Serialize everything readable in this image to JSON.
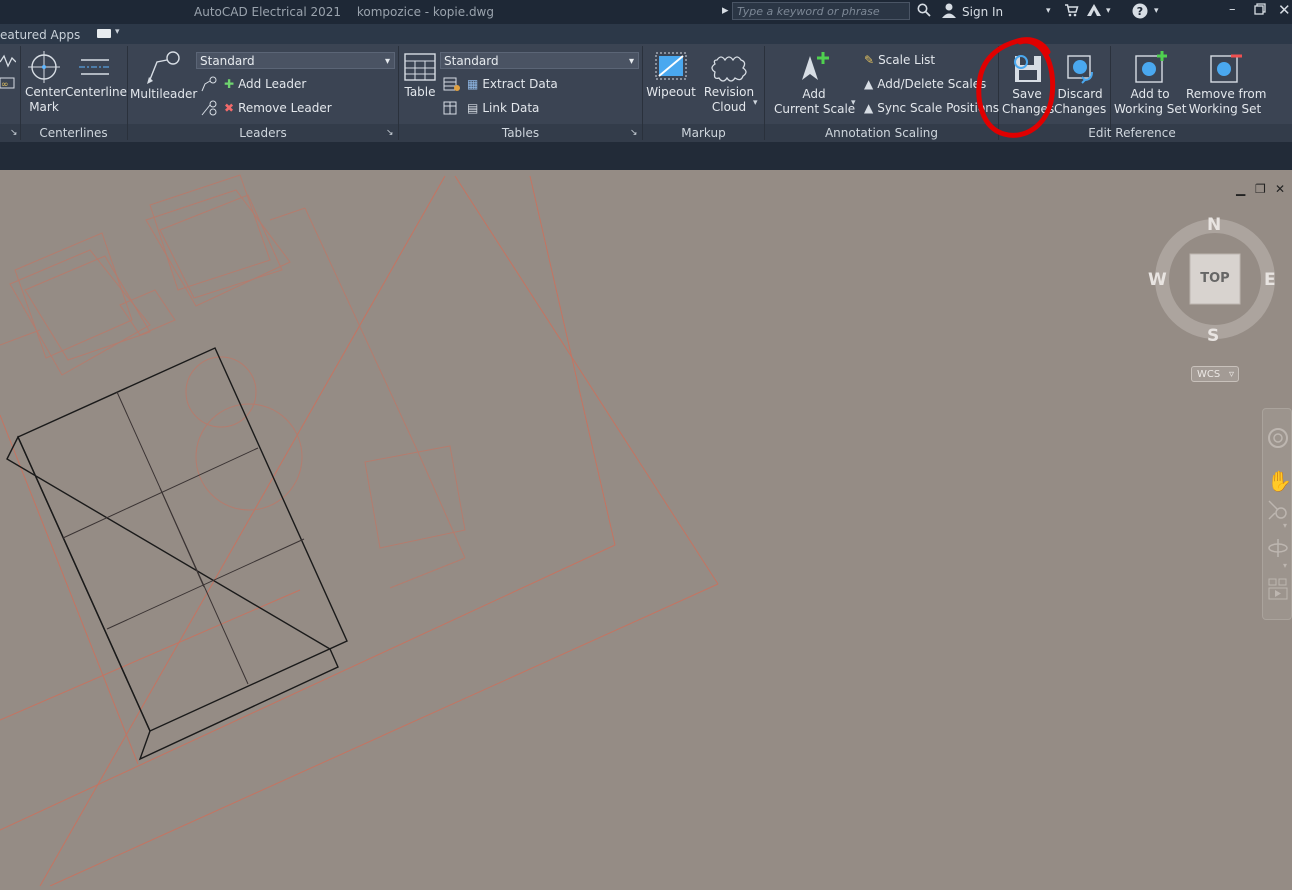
{
  "titlebar": {
    "app": "AutoCAD Electrical 2021",
    "file": "kompozice - kopie.dwg",
    "search_placeholder": "Type a keyword or phrase",
    "sign_in": "Sign In"
  },
  "tabs": {
    "featured": "eatured Apps"
  },
  "ribbon": {
    "centerlines": {
      "center_mark": "Center\nMark",
      "centerline": "Centerline",
      "label": "Centerlines"
    },
    "leaders": {
      "multileader": "Multileader",
      "style": "Standard",
      "add_leader": "Add Leader",
      "remove_leader": "Remove Leader",
      "label": "Leaders"
    },
    "tables": {
      "table": "Table",
      "style": "Standard",
      "extract_data": "Extract Data",
      "link_data": "Link Data",
      "label": "Tables"
    },
    "markup": {
      "wipeout": "Wipeout",
      "revision_cloud": "Revision\nCloud",
      "label": "Markup"
    },
    "annotation_scaling": {
      "add_current_scale": "Add\nCurrent Scale",
      "scale_list": "Scale List",
      "add_delete_scales": "Add/Delete Scales",
      "sync_scale_positions": "Sync Scale Positions",
      "label": "Annotation Scaling"
    },
    "edit_reference": {
      "save_changes": "Save\nChanges",
      "discard_changes": "Discard\nChanges",
      "add_to_working_set": "Add to\nWorking Set",
      "remove_from_working_set": "Remove from\nWorking Set",
      "label": "Edit Reference"
    }
  },
  "viewcube": {
    "n": "N",
    "s": "S",
    "e": "E",
    "w": "W",
    "top": "TOP",
    "wcs": "WCS"
  },
  "colors": {
    "accent_red": "#e00000",
    "canvas": "#958c85",
    "ribbon": "#3b4453"
  }
}
